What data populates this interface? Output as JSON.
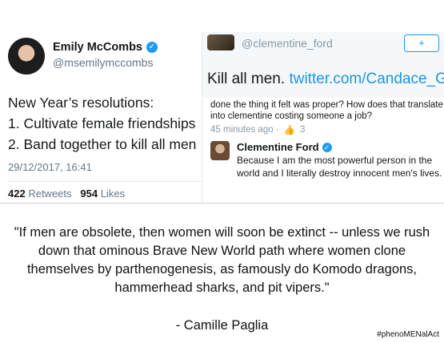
{
  "left_tweet": {
    "name": "Emily McCombs",
    "handle": "@msemilymccombs",
    "lines": [
      "New Year’s resolutions:",
      "1. Cultivate female friendships",
      "2. Band together to kill all men"
    ],
    "timestamp": "29/12/2017, 16:41",
    "retweets_count": "422",
    "retweets_label": "Retweets",
    "likes_count": "954",
    "likes_label": "Likes"
  },
  "right_top_tweet": {
    "handle": "@clementine_ford",
    "text": "Kill all men.",
    "link": "twitter.com/Candace_Garsi"
  },
  "right_bottom": {
    "previous_text": "done the thing it felt was proper? How does that translate into clementine costing someone a job?",
    "time_ago": "45 minutes ago ·",
    "like_count": "3",
    "reply_name": "Clementine Ford",
    "reply_text": "Because I am the most powerful person in the world and I literally destroy innocent men's lives."
  },
  "quote": {
    "text": "\"If men are obsolete, then women will soon be extinct -- unless we rush down that ominous Brave New World path where women clone themselves by parthenogenesis, as famously do Komodo dragons, hammerhead sharks, and pit vipers.\"",
    "attribution": "- Camille Paglia",
    "hashtag": "#phenoMENalAct"
  }
}
